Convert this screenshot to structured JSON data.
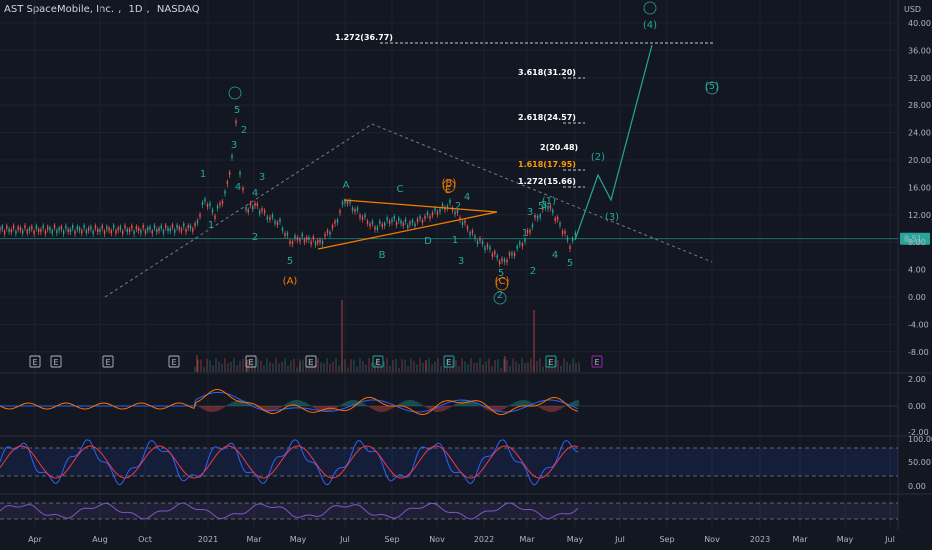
{
  "header": {
    "symbol_name": "AST SpaceMobile, Inc.",
    "interval": "1D",
    "exchange": "NASDAQ",
    "currency": "USD"
  },
  "colors": {
    "background": "#131722",
    "grid": "#1e222d",
    "text": "#b2b5be",
    "wave_green": "#26a69a",
    "wave_orange": "#f57c00",
    "price_line": "#26a69a",
    "price_badge": "#26a69a",
    "macd_line": "#2962ff",
    "signal_line": "#ff6d00",
    "stoch_k": "#2962ff",
    "stoch_d": "#f23645",
    "rsi_line": "#7e57c2",
    "triangle": "#f57c00",
    "trendline": "#787b86",
    "fib_lines": "#d1d4dc"
  },
  "price_axis": {
    "ticks": [
      "40.00",
      "36.00",
      "32.00",
      "28.00",
      "24.00",
      "20.00",
      "16.00",
      "12.00",
      "8.00",
      "4.00",
      "0.00",
      "-4.00",
      "-8.00"
    ],
    "current_price": "8.51"
  },
  "macd_axis": {
    "ticks": [
      "2.00",
      "0.00",
      "-2.00"
    ]
  },
  "stoch_axis": {
    "ticks": [
      "100.00",
      "50.00",
      "0.00"
    ]
  },
  "time_axis": {
    "labels": [
      "Apr",
      "Aug",
      "Oct",
      "2021",
      "Mar",
      "May",
      "Jul",
      "Sep",
      "Nov",
      "2022",
      "Mar",
      "May",
      "Jul",
      "Sep",
      "Nov",
      "2023",
      "Mar",
      "May",
      "Jul"
    ]
  },
  "fib_levels": [
    {
      "label": "1.272(36.77)",
      "color": "#ffffff"
    },
    {
      "label": "3.618(31.20)",
      "color": "#ffffff"
    },
    {
      "label": "2.618(24.57)",
      "color": "#ffffff"
    },
    {
      "label": "2(20.48)",
      "color": "#ffffff"
    },
    {
      "label": "1.618(17.95)",
      "color": "#ff9800"
    },
    {
      "label": "1.272(15.66)",
      "color": "#ffffff"
    }
  ],
  "wave_labels": [
    "1",
    "5",
    "2",
    "3",
    "4",
    "1",
    "2",
    "3",
    "4",
    "5",
    "(A)",
    "A",
    "B",
    "C",
    "D",
    "E",
    "(B)",
    "1",
    "2",
    "3",
    "4",
    "5",
    "(C)",
    "2",
    "3",
    "1",
    "5",
    "(1)",
    "2",
    "3",
    "4",
    "5",
    "(2)",
    "(3)",
    "(4)",
    "(5)",
    "(3)"
  ],
  "earnings_markers": [
    "E",
    "E",
    "E",
    "E",
    "E",
    "E",
    "E",
    "E",
    "E",
    "E"
  ]
}
